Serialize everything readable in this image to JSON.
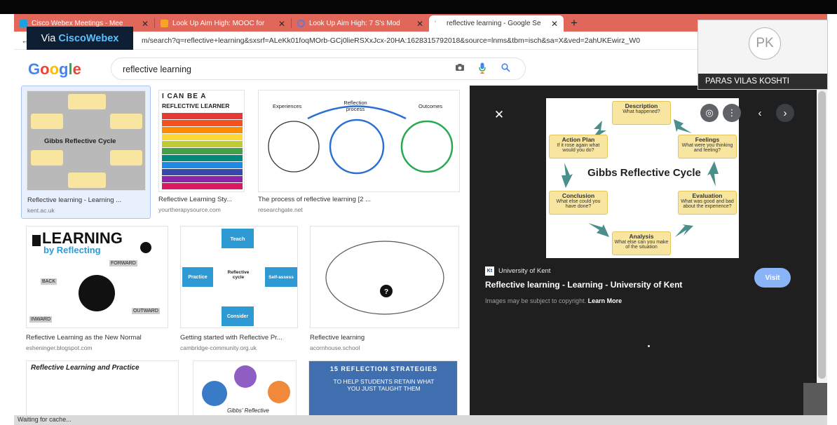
{
  "browser": {
    "tabs": [
      {
        "title": "Cisco Webex Meetings - Mee",
        "favicon_color": "#1fa0e0"
      },
      {
        "title": "Look Up Aim High: MOOC for",
        "favicon_color": "#f5a623"
      },
      {
        "title": "Look Up Aim High: 7 S's Mod",
        "favicon_color": "#5b7de0"
      },
      {
        "title": "reflective learning - Google Se",
        "favicon_color": "#ffffff"
      }
    ],
    "new_tab": "+",
    "address": "m/search?q=reflective+learning&sxsrf=ALeKk01foqMOrb-GCj0lieRSXxJcx-20HA:1628315792018&source=lnms&tbm=isch&sa=X&ved=2ahUKEwirz_W0"
  },
  "webex": {
    "prefix": "Via ",
    "brand": "CiscoWebex"
  },
  "participant": {
    "initials": "PK",
    "name": "PARAS VILAS KOSHTI"
  },
  "google": {
    "logo": [
      "G",
      "o",
      "o",
      "g",
      "l",
      "e"
    ],
    "logo_colors": [
      "#4285f4",
      "#ea4335",
      "#fbbc05",
      "#4285f4",
      "#34a853",
      "#ea4335"
    ],
    "query": "reflective learning"
  },
  "results": [
    {
      "caption": "Reflective learning - Learning ...",
      "source": "kent.ac.uk"
    },
    {
      "caption": "Reflective Learning Sty...",
      "source": "yourtherapysource.com"
    },
    {
      "caption": "The process of reflective learning [2 ...",
      "source": "researchgate.net"
    },
    {
      "caption": "Reflective Learning as the New Normal",
      "source": "esheninger.blogspot.com"
    },
    {
      "caption": "Getting started with Reflective Pr...",
      "source": "cambridge-community.org.uk"
    },
    {
      "caption": "Reflective learning",
      "source": "acornhouse.school"
    }
  ],
  "thumb_text": {
    "gibbs_small_title": "Gibbs Reflective Cycle",
    "learner_title": "REFLECTIVE LEARNER",
    "learner_cando": "I CAN BE A",
    "process": {
      "experiences": "Experiences",
      "process": "Reflection process",
      "outcomes": "Outcomes"
    },
    "learning_word": "LEARNING",
    "by_reflecting": "by Reflecting",
    "forward": "FORWARD",
    "back": "BACK",
    "inward": "INWARD",
    "outward": "OUTWARD",
    "cycle": {
      "teach": "Teach",
      "practice": "Practice",
      "center": "Reflective cycle",
      "assess": "Self-assess",
      "consider": "Consider"
    },
    "strategies_title": "15 REFLECTION STRATEGIES",
    "strategies_sub": "TO HELP STUDENTS RETAIN WHAT YOU JUST TAUGHT THEM",
    "practice_title": "Reflective Learning and Practice",
    "gibbs_reflective": "Gibbs' Reflective"
  },
  "preview": {
    "site": "University of Kent",
    "site_icon": "Kt",
    "title": "Reflective learning - Learning - University of Kent",
    "copyright": "Images may be subject to copyright.",
    "learn_more": "Learn More",
    "visit": "Visit",
    "diagram": {
      "title": "Gibbs Reflective Cycle",
      "description": {
        "title": "Description",
        "sub": "What happened?"
      },
      "feelings": {
        "title": "Feelings",
        "sub": "What were you thinking and feeling?"
      },
      "evaluation": {
        "title": "Evaluation",
        "sub": "What was good and bad about the experience?"
      },
      "analysis": {
        "title": "Analysis",
        "sub": "What else can you make of the situation"
      },
      "conclusion": {
        "title": "Conclusion",
        "sub": "What else could you have done?"
      },
      "action": {
        "title": "Action Plan",
        "sub": "If it rose again what would you do?"
      }
    }
  },
  "status": "Waiting for cache..."
}
